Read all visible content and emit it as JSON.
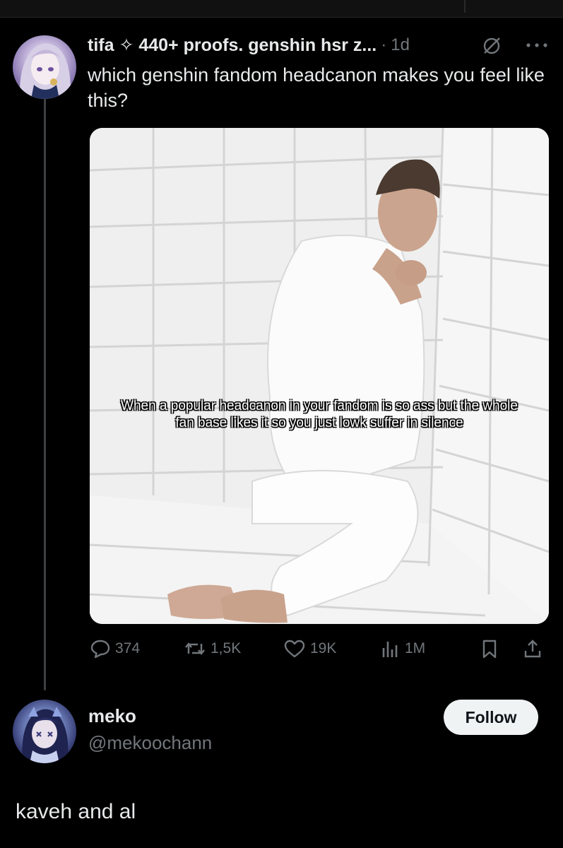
{
  "tweet": {
    "display_name": "tifa ✧ 440+ proofs. genshin hsr z...",
    "time": "1d",
    "text": "which genshin fandom headcanon makes you feel like this?",
    "image_caption": "When a popular headcanon in your fandom is so ass but the whole fan base likes it so you just lowk suffer in silence",
    "stats": {
      "replies": "374",
      "reposts": "1,5K",
      "likes": "19K",
      "views": "1M"
    }
  },
  "reply": {
    "display_name": "meko",
    "handle": "@mekoochann",
    "follow_label": "Follow",
    "text": "kaveh and al"
  },
  "icons": {
    "mute": "slashed-circle-icon",
    "more": "more-dots-icon",
    "reply": "speech-bubble-icon",
    "repost": "repost-arrows-icon",
    "like": "heart-icon",
    "views": "bar-chart-icon",
    "bookmark": "bookmark-icon",
    "share": "share-upload-icon"
  },
  "colors": {
    "background": "#000000",
    "text": "#e7e9ea",
    "muted": "#71767b",
    "follow_bg": "#eff3f4"
  }
}
